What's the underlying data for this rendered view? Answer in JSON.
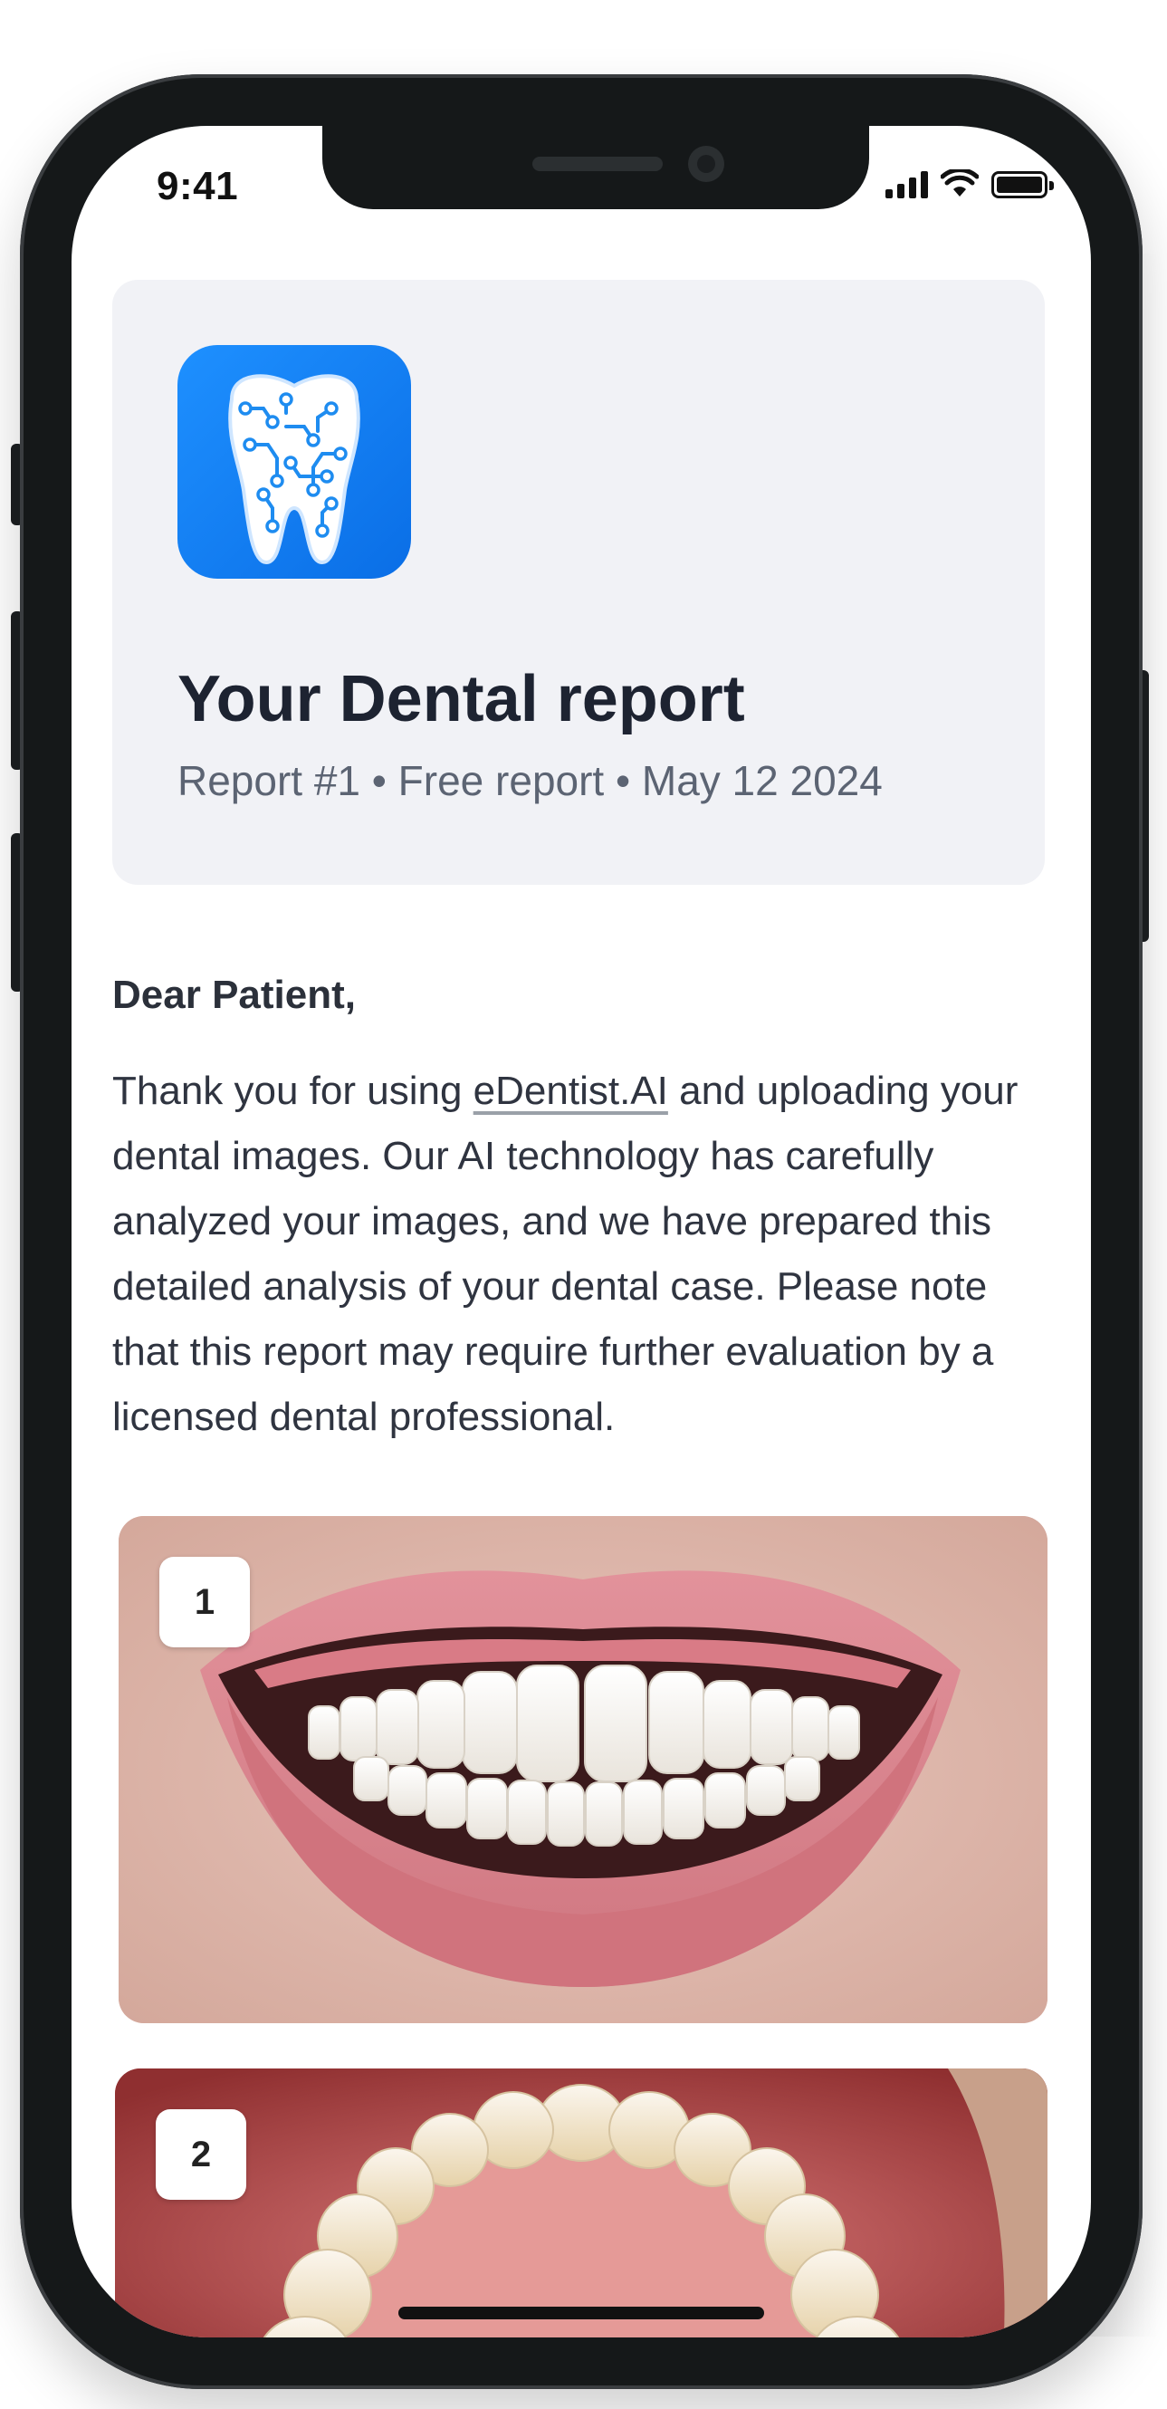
{
  "status_bar": {
    "time": "9:41"
  },
  "header": {
    "title": "Your Dental report",
    "meta": "Report #1 • Free report • May 12 2024"
  },
  "letter": {
    "greeting": "Dear Patient,",
    "intro_before_link": "Thank you for using ",
    "link_text": "eDentist.AI",
    "intro_after_link": " and uploading your dental images. Our AI technology has carefully analyzed your images, and we have prepared this detailed analysis of your dental case. Please note that this report may require further evaluation by a licensed dental professional."
  },
  "images": [
    {
      "badge": "1"
    },
    {
      "badge": "2"
    }
  ],
  "colors": {
    "accent_blue": "#0a6ee6",
    "card_bg": "#f1f2f6",
    "title": "#1d2331",
    "meta": "#5c6473"
  }
}
